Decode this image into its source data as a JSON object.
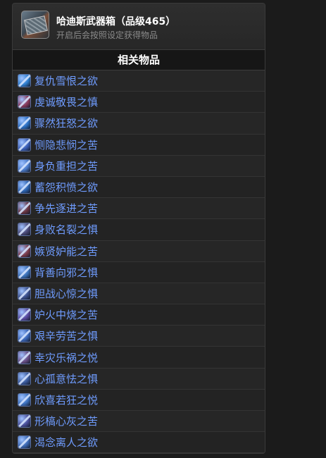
{
  "header": {
    "title": "哈迪斯武器箱（品级465）",
    "subtitle": "开启后会按照设定获得物品"
  },
  "section": {
    "title": "相关物品"
  },
  "items": [
    {
      "name": "复仇雪恨之欲",
      "icon_color": "#2f7fd0"
    },
    {
      "name": "虔诚敬畏之慎",
      "icon_color": "#8a3a5a"
    },
    {
      "name": "骤然狂怒之欲",
      "icon_color": "#2a6fc4"
    },
    {
      "name": "恻隐悲悯之苦",
      "icon_color": "#3b5fb8"
    },
    {
      "name": "身负重担之苦",
      "icon_color": "#4b7ccc"
    },
    {
      "name": "蓄怨积愤之欲",
      "icon_color": "#2c63b0"
    },
    {
      "name": "争先逐进之苦",
      "icon_color": "#6a3440"
    },
    {
      "name": "身败名裂之惧",
      "icon_color": "#4b4a78"
    },
    {
      "name": "嫉贤妒能之苦",
      "icon_color": "#7d3b4a"
    },
    {
      "name": "背善向邪之惧",
      "icon_color": "#3970b8"
    },
    {
      "name": "胆战心惊之惧",
      "icon_color": "#3a4f8c"
    },
    {
      "name": "妒火中烧之苦",
      "icon_color": "#5a4aa0"
    },
    {
      "name": "艰辛劳苦之惧",
      "icon_color": "#3a66b8"
    },
    {
      "name": "幸灾乐祸之悦",
      "icon_color": "#6a4f86"
    },
    {
      "name": "心孤意怯之惧",
      "icon_color": "#3a5a9c"
    },
    {
      "name": "欣喜若狂之悦",
      "icon_color": "#3d72c0"
    },
    {
      "name": "形槁心灰之苦",
      "icon_color": "#4a4f9a"
    },
    {
      "name": "渴念离人之欲",
      "icon_color": "#3a68b4"
    }
  ]
}
